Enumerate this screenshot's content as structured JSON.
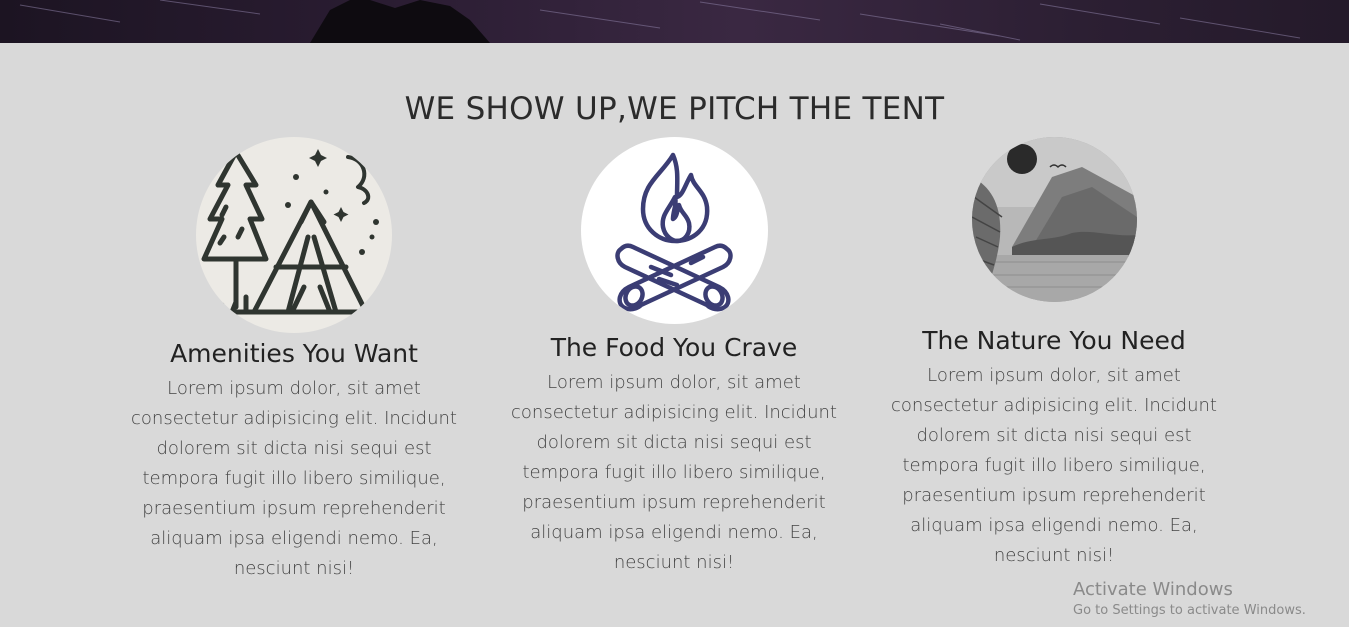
{
  "section": {
    "title": "WE SHOW UP,WE PITCH THE TENT"
  },
  "features": [
    {
      "icon": "camping-tent-tree-icon",
      "title": "Amenities You Want",
      "text": "Lorem ipsum dolor, sit amet consectetur adipisicing elit. Incidunt dolorem sit dicta nisi sequi est tempora fugit illo libero similique, praesentium ipsum reprehenderit aliquam ipsa eligendi nemo. Ea, nesciunt nisi!"
    },
    {
      "icon": "campfire-icon",
      "title": "The Food You Crave",
      "text": "Lorem ipsum dolor, sit amet consectetur adipisicing elit. Incidunt dolorem sit dicta nisi sequi est tempora fugit illo libero similique, praesentium ipsum reprehenderit aliquam ipsa eligendi nemo. Ea, nesciunt nisi!"
    },
    {
      "icon": "mountain-landscape-sketch-icon",
      "title": "The Nature You Need",
      "text": "Lorem ipsum dolor, sit amet consectetur adipisicing elit. Incidunt dolorem sit dicta nisi sequi est tempora fugit illo libero similique, praesentium ipsum reprehenderit aliquam ipsa eligendi nemo. Ea, nesciunt nisi!"
    }
  ],
  "watermark": {
    "title": "Activate Windows",
    "subtitle": "Go to Settings to activate Windows."
  },
  "colors": {
    "background": "#d9d9d9",
    "campfire": "#3b3d74",
    "icon_dark": "#2f3530"
  }
}
